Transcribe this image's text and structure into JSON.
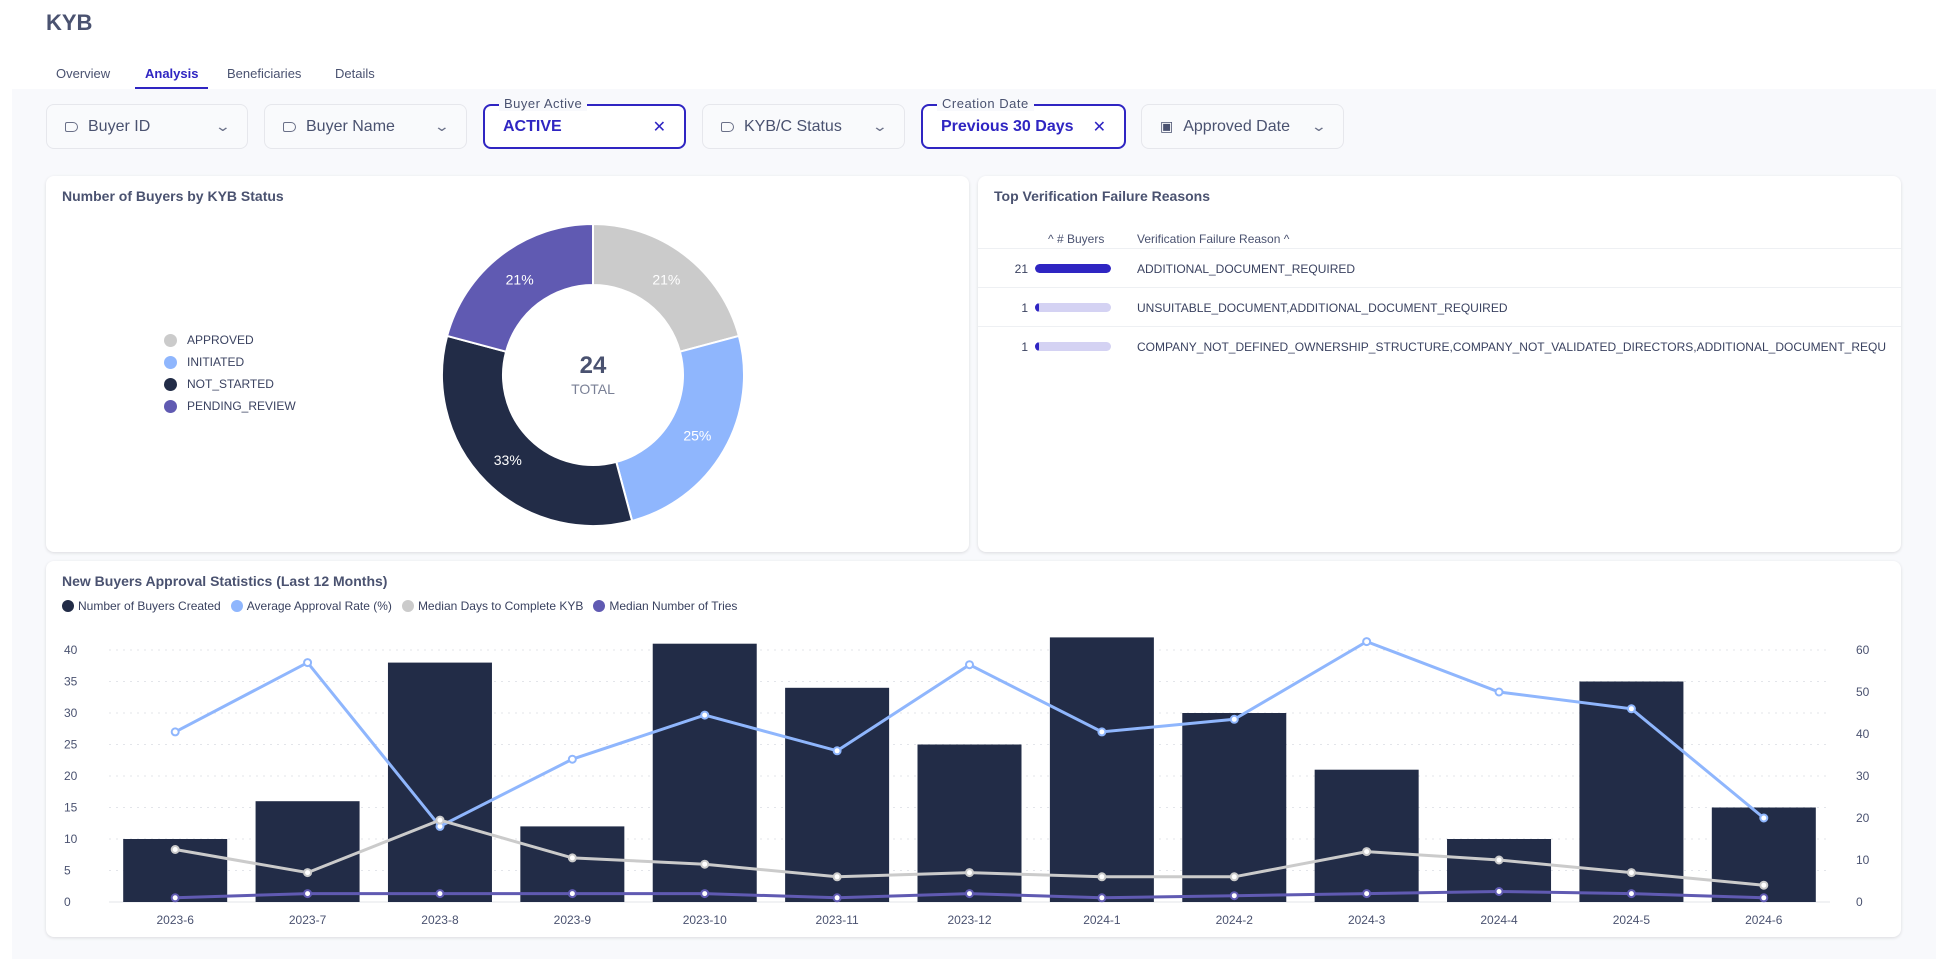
{
  "header": {
    "title": "KYB",
    "tabs": [
      {
        "label": "Overview"
      },
      {
        "label": "Analysis",
        "active": true
      },
      {
        "label": "Beneficiaries"
      },
      {
        "label": "Details"
      }
    ]
  },
  "filters": [
    {
      "label": "Buyer ID",
      "icon": "tag-icon"
    },
    {
      "label": "Buyer Name",
      "icon": "tag-icon"
    },
    {
      "title": "Buyer Active",
      "value": "ACTIVE"
    },
    {
      "label": "KYB/C Status",
      "icon": "tag-icon"
    },
    {
      "title": "Creation Date",
      "value": "Previous 30 Days"
    },
    {
      "label": "Approved Date",
      "icon": "calendar-icon"
    }
  ],
  "colors": {
    "accent": "#2f25c2",
    "navy": "#222c47",
    "lightblue": "#8fb6fd",
    "gray": "#cbcbcb",
    "purple": "#605ab2"
  },
  "donut": {
    "title": "Number of Buyers by KYB Status",
    "total": "24",
    "total_label": "TOTAL",
    "chart_data": {
      "type": "pie",
      "categories": [
        "APPROVED",
        "INITIATED",
        "NOT_STARTED",
        "PENDING_REVIEW"
      ],
      "values": [
        5,
        6,
        8,
        5
      ],
      "labels": [
        "21%",
        "25%",
        "33%",
        "21%"
      ],
      "colors": [
        "#cbcbcb",
        "#8fb6fd",
        "#222c47",
        "#605ab2"
      ],
      "legend": "left"
    }
  },
  "failures": {
    "title": "Top Verification Failure Reasons",
    "col_count": "# Buyers",
    "col_reason": "Verification Failure Reason",
    "max": 21,
    "rows": [
      {
        "count": "21",
        "value": 21,
        "reason": "ADDITIONAL_DOCUMENT_REQUIRED"
      },
      {
        "count": "1",
        "value": 1,
        "reason": "UNSUITABLE_DOCUMENT,ADDITIONAL_DOCUMENT_REQUIRED"
      },
      {
        "count": "1",
        "value": 1,
        "reason": "COMPANY_NOT_DEFINED_OWNERSHIP_STRUCTURE,COMPANY_NOT_VALIDATED_DIRECTORS,ADDITIONAL_DOCUMENT_REQU"
      }
    ]
  },
  "stats": {
    "title": "New Buyers Approval Statistics (Last 12 Months)",
    "chart_data": {
      "type": "bar",
      "categories": [
        "2023-6",
        "2023-7",
        "2023-8",
        "2023-9",
        "2023-10",
        "2023-11",
        "2023-12",
        "2024-1",
        "2024-2",
        "2024-3",
        "2024-4",
        "2024-5",
        "2024-6"
      ],
      "ylim": [
        0,
        40
      ],
      "yticks": [
        0,
        5,
        10,
        15,
        20,
        25,
        30,
        35,
        40
      ],
      "y2lim": [
        0,
        60
      ],
      "y2ticks": [
        0,
        10,
        20,
        30,
        40,
        50,
        60
      ],
      "grid": true,
      "legend": "top-left",
      "series": [
        {
          "name": "Number of Buyers Created",
          "type": "bar",
          "axis": "left",
          "color": "#222c47",
          "values": [
            10,
            16,
            38,
            12,
            41,
            34,
            25,
            42,
            30,
            21,
            10,
            35,
            15
          ]
        },
        {
          "name": "Average Approval Rate (%)",
          "type": "line",
          "axis": "right",
          "color": "#8fb6fd",
          "values": [
            40.5,
            57,
            18,
            34,
            44.5,
            36,
            56.5,
            40.5,
            43.5,
            62,
            50,
            46,
            20
          ]
        },
        {
          "name": "Median Days to Complete KYB",
          "type": "line",
          "axis": "right",
          "color": "#cbcbcb",
          "values": [
            12.5,
            7,
            19.5,
            10.5,
            9,
            6,
            7,
            6,
            6,
            12,
            10,
            7,
            4
          ]
        },
        {
          "name": "Median Number of Tries",
          "type": "line",
          "axis": "right",
          "color": "#605ab2",
          "values": [
            1,
            2,
            2,
            2,
            2,
            1,
            2,
            1,
            1.5,
            2,
            2.5,
            2,
            1
          ]
        }
      ]
    }
  }
}
